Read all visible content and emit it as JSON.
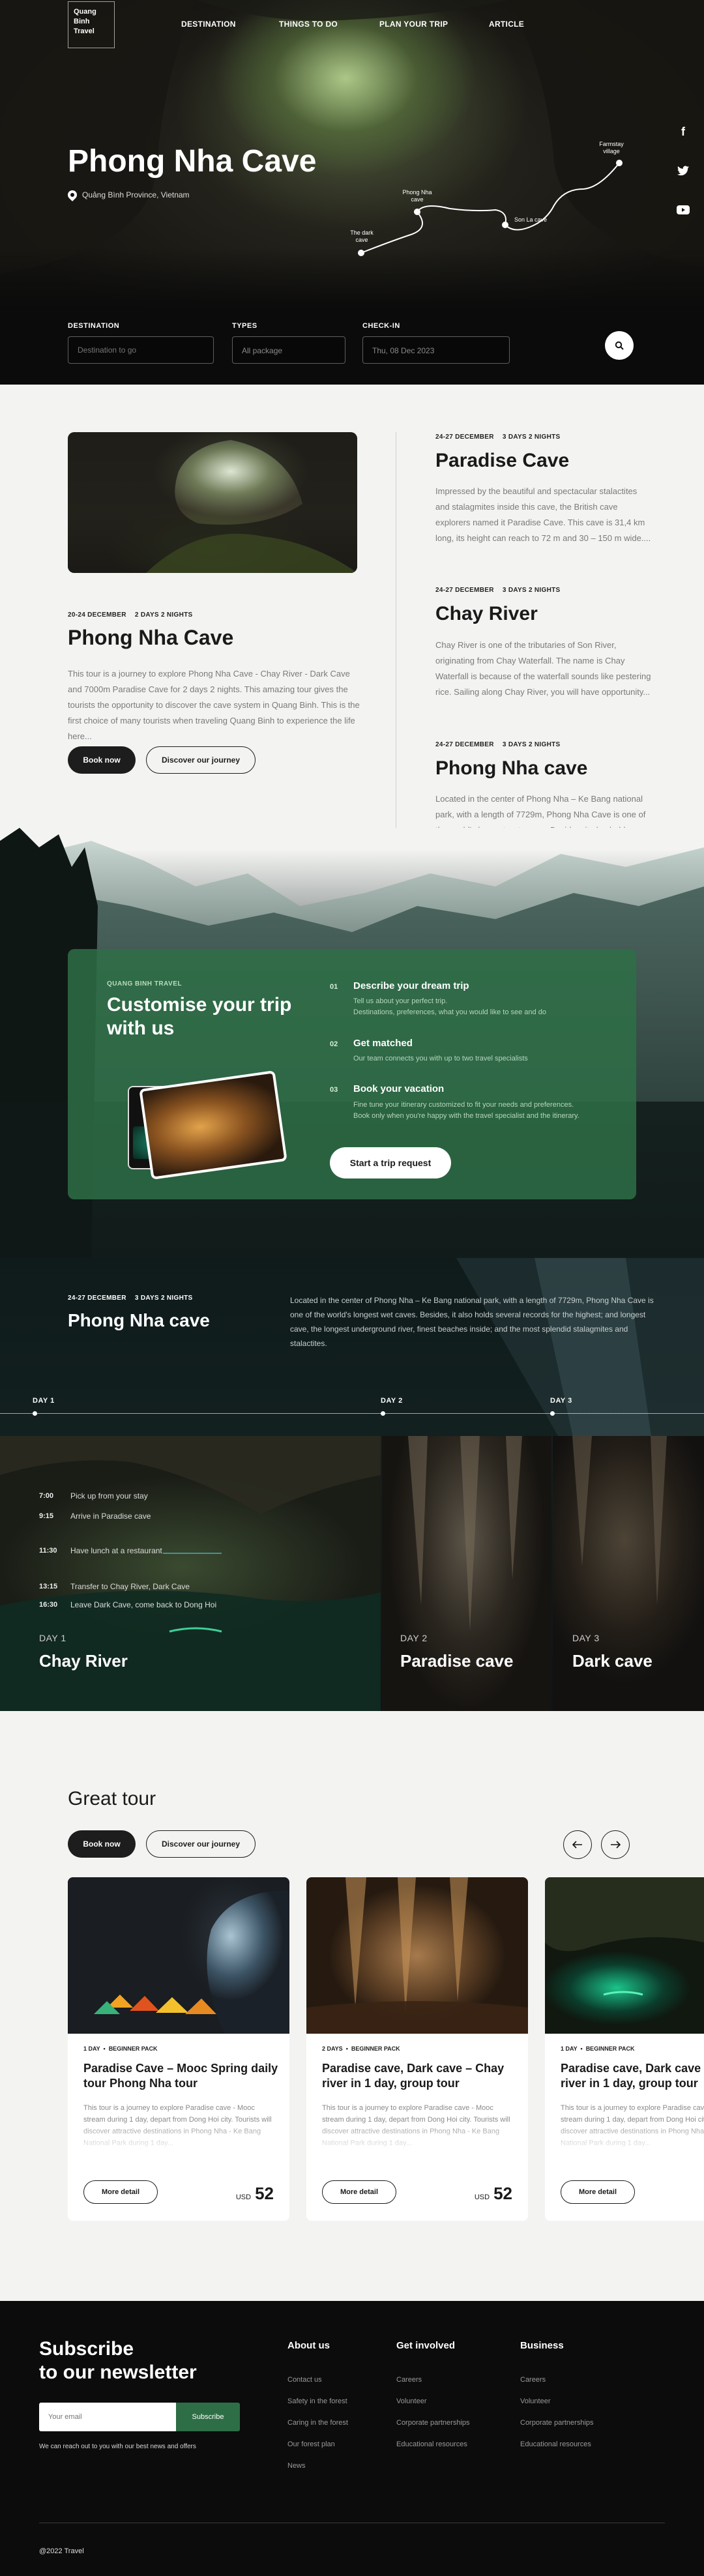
{
  "brand": {
    "line1": "Quang",
    "line2": "Binh",
    "line3": "Travel"
  },
  "nav": [
    "DESTINATION",
    "THINGS TO DO",
    "PLAN YOUR TRIP",
    "ARTICLE"
  ],
  "hero": {
    "title": "Phong Nha Cave",
    "location": "Quảng Bình Province, Vietnam",
    "map_labels": {
      "farmstay": "Farmstay village",
      "phong_nha": "Phong Nha cave",
      "dark": "The dark cave",
      "son_la": "Son La cave"
    }
  },
  "social_icons": [
    "facebook-icon",
    "twitter-icon",
    "youtube-icon"
  ],
  "search": {
    "destination_label": "DESTINATION",
    "destination_placeholder": "Destination to go",
    "types_label": "TYPES",
    "types_value": "All package",
    "checkin_label": "CHECK-IN",
    "checkin_value": "Thu, 08 Dec 2023"
  },
  "featured": {
    "date": "20-24 DECEMBER",
    "duration": "2 DAYS 2 NIGHTS",
    "title": "Phong Nha Cave",
    "description": "This tour is a journey to explore Phong Nha Cave - Chay River - Dark Cave and 7000m Paradise Cave for 2 days 2 nights. This amazing tour gives the tourists the opportunity to discover the cave system in Quang Binh. This is the first choice of many tourists when traveling Quang Binh to experience the life here...",
    "book_label": "Book now",
    "discover_label": "Discover our journey"
  },
  "side_tours": [
    {
      "date": "24-27 DECEMBER",
      "duration": "3 DAYS 2 NIGHTS",
      "title": "Paradise Cave",
      "description": "Impressed by the beautiful and spectacular stalactites and stalagmites inside this cave, the British cave explorers named it Paradise Cave. This cave is 31,4 km long, its height can reach to 72 m and 30 – 150 m wide...."
    },
    {
      "date": "24-27 DECEMBER",
      "duration": "3 DAYS 2 NIGHTS",
      "title": "Chay River",
      "description": "Chay River is one of the tributaries of Son River, originating from Chay Waterfall. The name is Chay Waterfall is because of the waterfall sounds like pestering rice. Sailing along Chay River, you will have opportunity..."
    },
    {
      "date": "24-27 DECEMBER",
      "duration": "3 DAYS 2 NIGHTS",
      "title": "Phong Nha cave",
      "description": "Located in the center of Phong Nha – Ke Bang national park, with a length of 7729m, Phong Nha Cave is one of the world's longest wet caves. Besides, it also holds several records for the highest; and longest cave, the..."
    }
  ],
  "customise": {
    "eyebrow": "QUANG BINH TRAVEL",
    "title_line1": "Customise your trip",
    "title_line2": "with us",
    "steps": [
      {
        "num": "01",
        "title": "Describe your dream trip",
        "desc1": "Tell us about your perfect trip.",
        "desc2": "Destinations, preferences, what you would like to see and do"
      },
      {
        "num": "02",
        "title": "Get matched",
        "desc1": "Our team connects you with up to two travel specialists",
        "desc2": ""
      },
      {
        "num": "03",
        "title": "Book your vacation",
        "desc1": "Fine tune your itinerary customized to fit your needs and preferences.",
        "desc2": "Book only when you're happy with the travel specialist and the itinerary."
      }
    ],
    "cta": "Start a trip request"
  },
  "itinerary": {
    "date": "24-27 DECEMBER",
    "duration": "3 DAYS 2 NIGHTS",
    "title": "Phong Nha cave",
    "description": "Located in the center of Phong Nha – Ke Bang national park, with a length of 7729m, Phong Nha Cave is one of the world's longest wet caves. Besides, it also holds several records for the highest; and longest cave, the longest underground river, finest beaches inside; and the most splendid stalagmites and stalactites.",
    "timeline": [
      "DAY 1",
      "DAY 2",
      "DAY 3"
    ],
    "schedule": [
      {
        "time": "7:00",
        "text": "Pick up from your stay"
      },
      {
        "time": "9:15",
        "text": "Arrive in Paradise cave"
      },
      {
        "time": "11:30",
        "text": "Have lunch at a restaurant"
      },
      {
        "time": "13:15",
        "text": "Transfer to Chay River, Dark Cave"
      },
      {
        "time": "16:30",
        "text": "Leave Dark Cave, come back to Dong Hoi"
      }
    ],
    "panels": [
      {
        "day": "DAY 1",
        "title": "Chay River"
      },
      {
        "day": "DAY 2",
        "title": "Paradise cave"
      },
      {
        "day": "DAY 3",
        "title": "Dark cave"
      }
    ]
  },
  "great_tour": {
    "title": "Great tour",
    "book_label": "Book now",
    "discover_label": "Discover our journey",
    "cards": [
      {
        "days": "1 DAY",
        "pack": "BEGINNER PACK",
        "title": "Paradise Cave – Mooc Spring daily tour Phong Nha tour",
        "desc": "This tour is a journey to explore Paradise cave - Mooc stream during 1 day, depart from Dong Hoi city. Tourists will discover attractive destinations in Phong Nha - Ke Bang National Park during 1 day...",
        "more": "More detail",
        "currency": "USD",
        "price": "52"
      },
      {
        "days": "2 DAYS",
        "pack": "BEGINNER PACK",
        "title": "Paradise cave, Dark cave – Chay river in 1 day, group tour",
        "desc": "This tour is a journey to explore Paradise cave - Mooc stream during 1 day, depart from Dong Hoi city. Tourists will discover attractive destinations in Phong Nha - Ke Bang National Park during 1 day...",
        "more": "More detail",
        "currency": "USD",
        "price": "52"
      },
      {
        "days": "1 DAY",
        "pack": "BEGINNER PACK",
        "title": "Paradise cave, Dark cave – Chay river in 1 day, group tour",
        "desc": "This tour is a journey to explore Paradise cave - Mooc stream during 1 day, depart from Dong Hoi city. Tourists will discover attractive destinations in Phong Nha - Ke Bang National Park during 1 day...",
        "more": "More detail",
        "currency": "USD",
        "price": "52"
      }
    ]
  },
  "footer": {
    "newsletter_line1": "Subscribe",
    "newsletter_line2": "to our newsletter",
    "email_placeholder": "Your email",
    "subscribe": "Subscribe",
    "note": "We can reach out to you with our best news and offers",
    "columns": [
      {
        "title": "About us",
        "links": [
          "Contact us",
          "Safety in the forest",
          "Caring in the forest",
          "Our forest plan",
          "News"
        ]
      },
      {
        "title": "Get involved",
        "links": [
          "Careers",
          "Volunteer",
          "Corporate partnerships",
          "Educational resources"
        ]
      },
      {
        "title": "Business",
        "links": [
          "Careers",
          "Volunteer",
          "Corporate partnerships",
          "Educational resources"
        ]
      }
    ],
    "copyright": "@2022 Travel"
  }
}
